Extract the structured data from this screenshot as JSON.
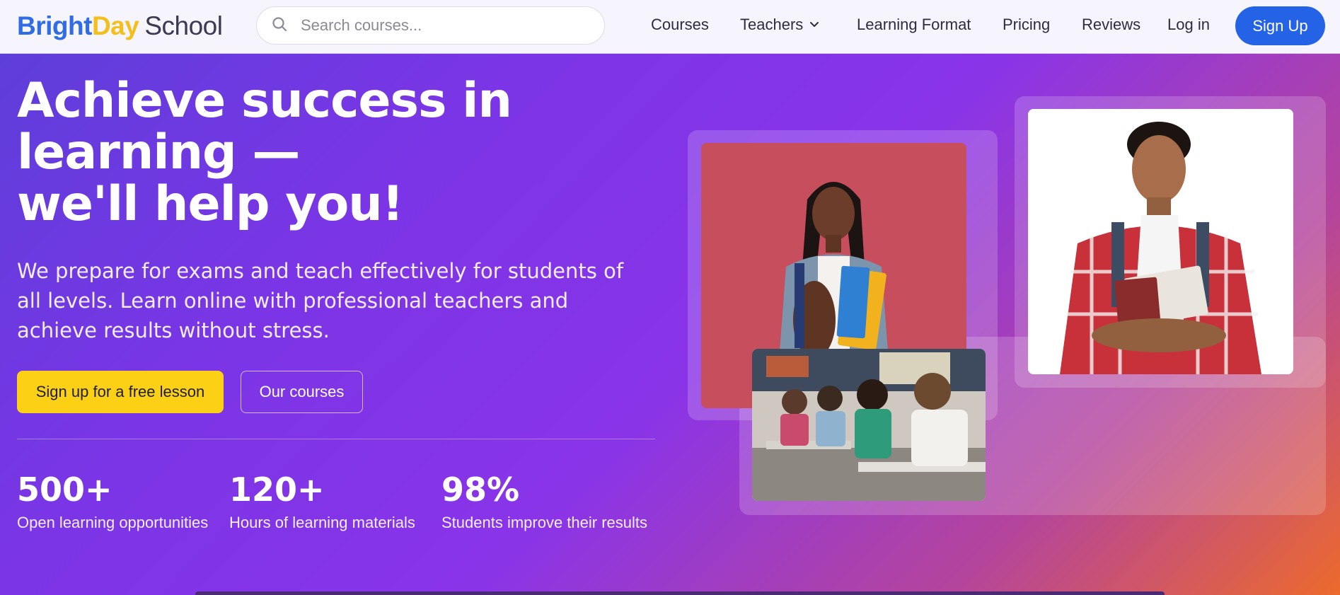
{
  "brand": {
    "part1": "Bright",
    "part2": "Day",
    "part3": "School"
  },
  "search": {
    "placeholder": "Search courses...",
    "value": ""
  },
  "nav": {
    "courses": "Courses",
    "teachers": "Teachers",
    "learning_format": "Learning Format",
    "pricing": "Pricing",
    "reviews": "Reviews",
    "login": "Log in",
    "signup": "Sign Up"
  },
  "hero": {
    "title_line1": "Achieve success in",
    "title_line2": "learning —",
    "title_line3": "we'll help you!",
    "description": "We prepare for exams and teach effectively for students of all levels. Learn online with professional teachers and achieve results without stress.",
    "primary_button": "Sign up for a free lesson",
    "secondary_button": "Our courses"
  },
  "stats": [
    {
      "value": "500+",
      "label": "Open learning opportunities"
    },
    {
      "value": "120+",
      "label": "Hours of learning materials"
    },
    {
      "value": "98%",
      "label": "Students improve their results"
    }
  ],
  "colors": {
    "primary_blue": "#2563e6",
    "accent_yellow": "#fcd015",
    "gradient_start": "#5b3fd9",
    "gradient_end": "#ec6a2c"
  }
}
